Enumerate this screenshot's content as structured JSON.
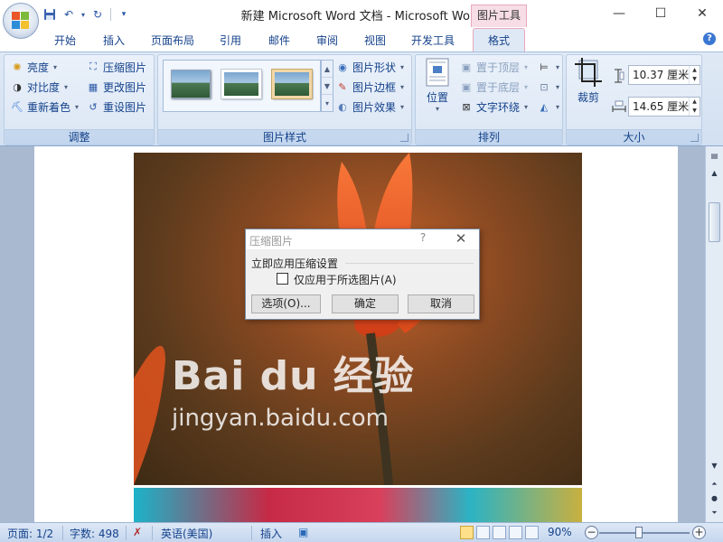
{
  "window": {
    "title": "新建 Microsoft Word 文档 - Microsoft Word",
    "tool_context": "图片工具",
    "minimize": "—",
    "maximize": "☐",
    "close": "✕"
  },
  "tabs": [
    {
      "label": "开始"
    },
    {
      "label": "插入"
    },
    {
      "label": "页面布局"
    },
    {
      "label": "引用"
    },
    {
      "label": "邮件"
    },
    {
      "label": "审阅"
    },
    {
      "label": "视图"
    },
    {
      "label": "开发工具"
    }
  ],
  "active_tab": "格式",
  "ribbon": {
    "adjust": {
      "label": "调整",
      "brightness": "亮度",
      "contrast": "对比度",
      "recolor": "重新着色",
      "compress": "压缩图片",
      "change": "更改图片",
      "reset": "重设图片"
    },
    "styles": {
      "label": "图片样式",
      "shape": "图片形状",
      "border": "图片边框",
      "effects": "图片效果"
    },
    "arrange": {
      "label": "排列",
      "position": "位置",
      "bring_front": "置于顶层",
      "send_back": "置于底层",
      "text_wrap": "文字环绕"
    },
    "size": {
      "label": "大小",
      "crop": "裁剪",
      "height": "10.37 厘米",
      "width": "14.65 厘米"
    }
  },
  "document": {
    "watermark_logo": "Bai du 经验",
    "watermark_url": "jingyan.baidu.com"
  },
  "dialog": {
    "title": "压缩图片",
    "help": "?",
    "close": "✕",
    "section": "立即应用压缩设置",
    "checkbox_label": "仅应用于所选图片(A)",
    "checkbox_checked": false,
    "options_button": "选项(O)...",
    "ok_button": "确定",
    "cancel_button": "取消"
  },
  "status": {
    "page": "页面: 1/2",
    "words": "字数: 498",
    "language": "英语(美国)",
    "mode": "插入",
    "zoom": "90%"
  },
  "colors": {
    "ribbon_bg": "#dfe9f5",
    "tool_tab": "#f6dde6",
    "text_blue": "#15428b"
  }
}
